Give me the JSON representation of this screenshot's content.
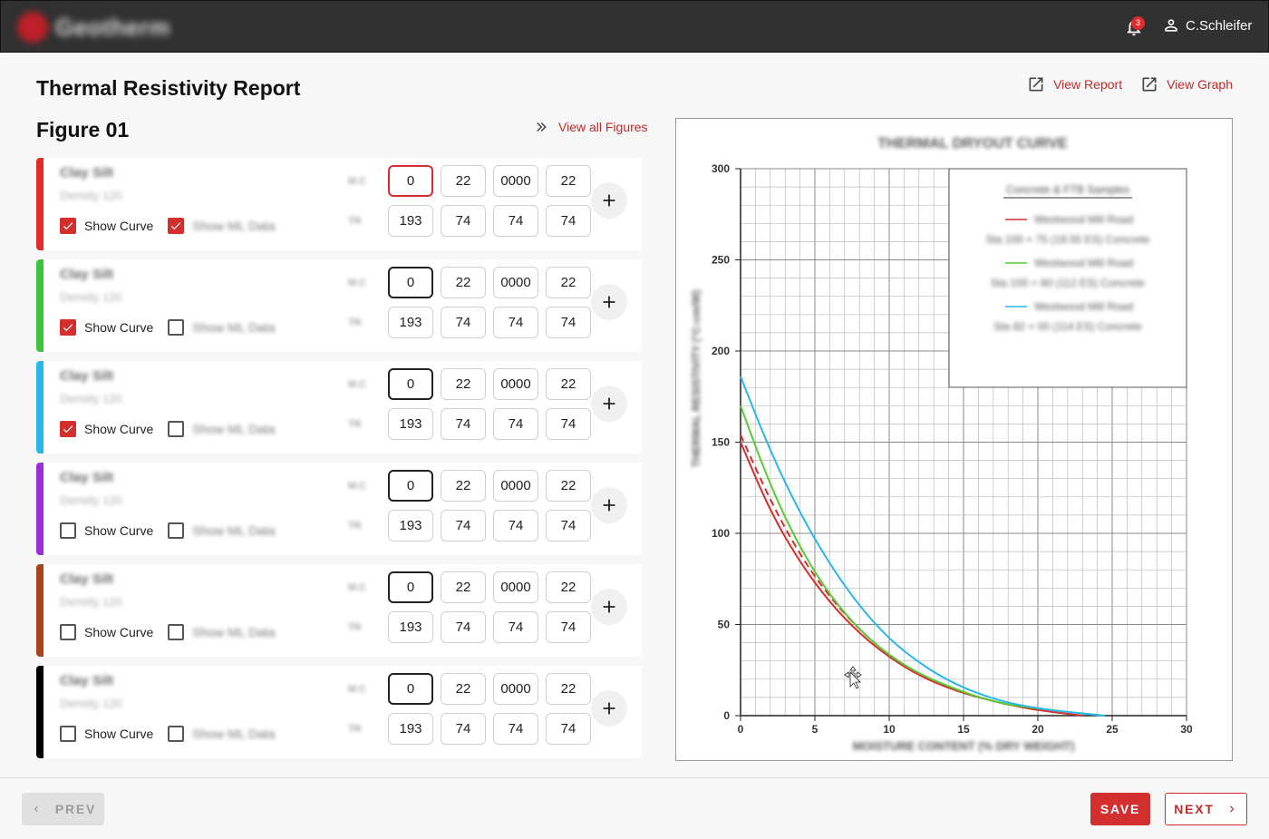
{
  "header": {
    "logo_text": "Geotherm",
    "notification_count": "3",
    "user_name": "C.Schleifer"
  },
  "page": {
    "title": "Thermal Resistivity Report",
    "view_report": "View Report",
    "view_graph": "View Graph"
  },
  "figure": {
    "title": "Figure 01",
    "view_all": "View all Figures"
  },
  "samples": [
    {
      "color": "#e32b2b",
      "name": "Clay Silt",
      "sub": "Density 120",
      "show_curve_label": "Show Curve",
      "show_curve": true,
      "show_ml_label": "Show ML Data",
      "show_ml": true,
      "row1_label": "M.C",
      "row2_label": "TR",
      "row1": [
        "0",
        "22",
        "0000",
        "22"
      ],
      "row2": [
        "193",
        "74",
        "74",
        "74"
      ]
    },
    {
      "color": "#3cc53c",
      "name": "Clay Silt",
      "sub": "Density 120",
      "show_curve_label": "Show Curve",
      "show_curve": true,
      "show_ml_label": "Show ML Data",
      "show_ml": false,
      "row1_label": "M.C",
      "row2_label": "TR",
      "row1": [
        "0",
        "22",
        "0000",
        "22"
      ],
      "row2": [
        "193",
        "74",
        "74",
        "74"
      ]
    },
    {
      "color": "#29b6e8",
      "name": "Clay Silt",
      "sub": "Density 120",
      "show_curve_label": "Show Curve",
      "show_curve": true,
      "show_ml_label": "Show ML Data",
      "show_ml": false,
      "row1_label": "M.C",
      "row2_label": "TR",
      "row1": [
        "0",
        "22",
        "0000",
        "22"
      ],
      "row2": [
        "193",
        "74",
        "74",
        "74"
      ]
    },
    {
      "color": "#9b2fd6",
      "name": "Clay Silt",
      "sub": "Density 120",
      "show_curve_label": "Show Curve",
      "show_curve": false,
      "show_ml_label": "Show ML Data",
      "show_ml": false,
      "row1_label": "M.C",
      "row2_label": "TR",
      "row1": [
        "0",
        "22",
        "0000",
        "22"
      ],
      "row2": [
        "193",
        "74",
        "74",
        "74"
      ]
    },
    {
      "color": "#a8441a",
      "name": "Clay Silt",
      "sub": "Density 120",
      "show_curve_label": "Show Curve",
      "show_curve": false,
      "show_ml_label": "Show ML Data",
      "show_ml": false,
      "row1_label": "M.C",
      "row2_label": "TR",
      "row1": [
        "0",
        "22",
        "0000",
        "22"
      ],
      "row2": [
        "193",
        "74",
        "74",
        "74"
      ]
    },
    {
      "color": "#000000",
      "name": "Clay Silt",
      "sub": "Density 120",
      "show_curve_label": "Show Curve",
      "show_curve": false,
      "show_ml_label": "Show ML Data",
      "show_ml": false,
      "row1_label": "M.C",
      "row2_label": "TR",
      "row1": [
        "0",
        "22",
        "0000",
        "22"
      ],
      "row2": [
        "193",
        "74",
        "74",
        "74"
      ]
    }
  ],
  "chart_data": {
    "type": "line",
    "title": "THERMAL DRYOUT CURVE",
    "xlabel": "MOISTURE CONTENT (% DRY WEIGHT)",
    "ylabel": "THERMAL RESISTIVITY (°C-cm/W)",
    "xlim": [
      0,
      30
    ],
    "ylim": [
      0,
      300
    ],
    "xticks": [
      "0",
      "5",
      "10",
      "15",
      "20",
      "25",
      "30"
    ],
    "yticks": [
      "0",
      "50",
      "100",
      "150",
      "200",
      "250",
      "300"
    ],
    "grid": true,
    "legend": {
      "placement": "top-right",
      "title": "Concrete & FTB Samples",
      "entries": [
        {
          "color": "#d32f2f",
          "line1": "Westwood Mill Road",
          "line2": "Sta 100 + 75 (18.55 ES) Concrete"
        },
        {
          "color": "#55cc33",
          "line1": "Westwood Mill Road",
          "line2": "Sta 100 + 80 (112 ES) Concrete"
        },
        {
          "color": "#29b6e8",
          "line1": "Westwood Mill Road",
          "line2": "Sta 82 + 00 (114 ES) Concrete"
        }
      ]
    },
    "series": [
      {
        "color": "#d32f2f",
        "dashed": false,
        "x": [
          0,
          2,
          4,
          6,
          8,
          10,
          12,
          14,
          16,
          18,
          20,
          22,
          23
        ],
        "y": [
          150,
          112,
          84,
          62,
          45,
          32,
          22,
          15,
          10,
          6,
          3,
          1,
          0
        ]
      },
      {
        "color": "#d32f2f",
        "dashed": true,
        "x": [
          0,
          2,
          4,
          6,
          8,
          10,
          12,
          14,
          16,
          18
        ],
        "y": [
          154,
          118,
          88,
          65,
          47,
          33,
          23,
          15,
          10,
          6
        ]
      },
      {
        "color": "#55cc33",
        "dashed": false,
        "x": [
          0,
          2,
          4,
          6,
          8,
          10,
          12,
          14,
          16,
          18,
          20,
          22,
          24.5
        ],
        "y": [
          170,
          126,
          92,
          66,
          47,
          33,
          23,
          16,
          10,
          6,
          4,
          2,
          0
        ]
      },
      {
        "color": "#29b6e8",
        "dashed": false,
        "x": [
          0,
          2,
          4,
          6,
          8,
          10,
          12,
          14,
          16,
          18,
          20,
          22,
          24.5
        ],
        "y": [
          186,
          145,
          111,
          83,
          60,
          42,
          29,
          19,
          12,
          7,
          4,
          2,
          0
        ]
      }
    ]
  },
  "footer": {
    "prev_label": "PREV",
    "save_label": "SAVE",
    "next_label": "NEXT"
  }
}
